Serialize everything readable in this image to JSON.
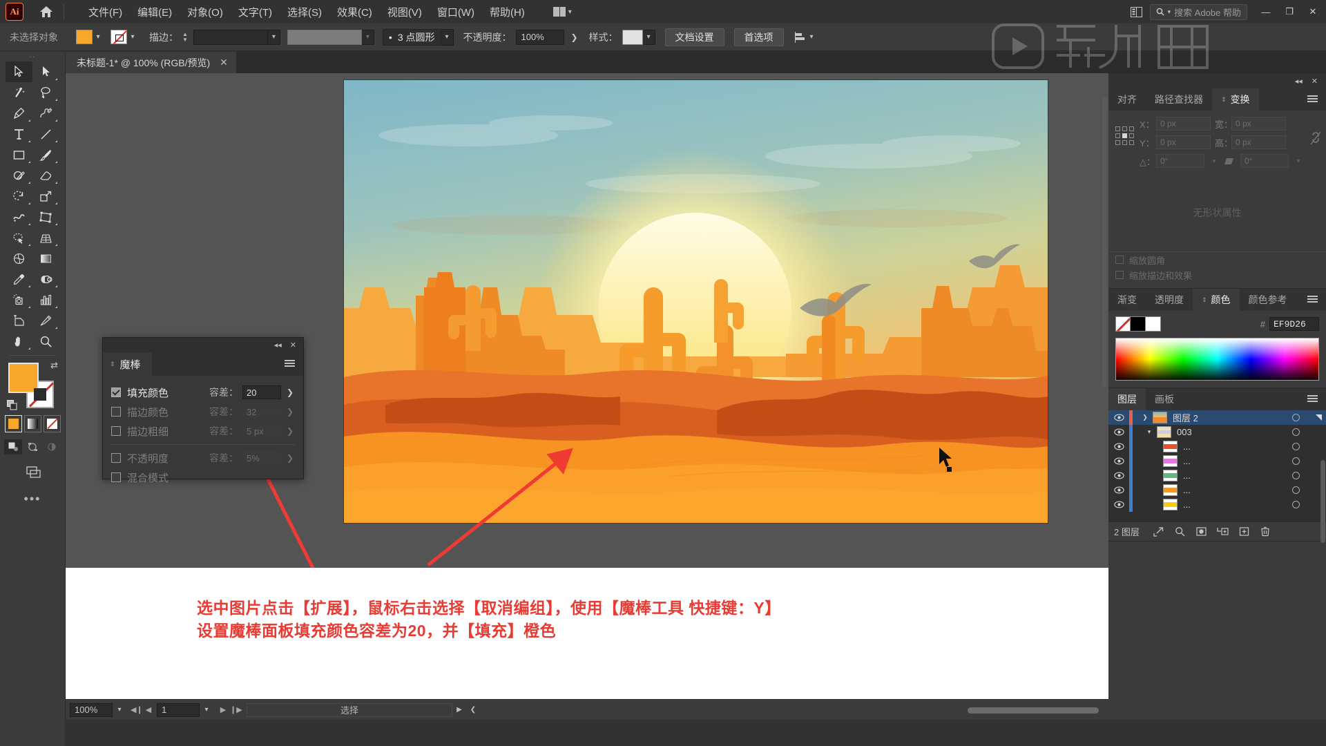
{
  "app": {
    "logo_text": "Ai",
    "title_suffix": ""
  },
  "menubar": {
    "items": [
      "文件(F)",
      "编辑(E)",
      "对象(O)",
      "文字(T)",
      "选择(S)",
      "效果(C)",
      "视图(V)",
      "窗口(W)",
      "帮助(H)"
    ],
    "home_icon": "home-icon",
    "workspace_icon": "workspace-switcher-icon",
    "search_placeholder": "搜索 Adobe 帮助",
    "search_icon": "search-icon",
    "arrange_icon": "arrange-documents-icon",
    "window_minimize": "—",
    "window_restore": "❐",
    "window_close": "✕"
  },
  "controlbar": {
    "selection_status": "未选择对象",
    "fill_swatch_color": "#F7A82B",
    "stroke_swatch": "none",
    "stroke_label": "描边：",
    "stroke_weight": "",
    "stroke_profile": "",
    "brush_bullet": "•",
    "brush_label": "3 点圆形",
    "opacity_label": "不透明度：",
    "opacity_value": "100%",
    "style_label": "样式：",
    "doc_setup_button": "文档设置",
    "preferences_button": "首选项",
    "align_icon": "align-icon"
  },
  "document_tab": {
    "title": "未标题-1* @ 100% (RGB/预览)",
    "close": "✕"
  },
  "toolbar": {
    "tools": [
      {
        "name": "selection-tool",
        "active": true
      },
      {
        "name": "direct-selection-tool",
        "active": false
      },
      {
        "name": "magic-wand-tool",
        "active": false
      },
      {
        "name": "lasso-tool",
        "active": false
      },
      {
        "name": "pen-tool",
        "active": false
      },
      {
        "name": "curvature-tool",
        "active": false
      },
      {
        "name": "type-tool",
        "active": false
      },
      {
        "name": "line-segment-tool",
        "active": false
      },
      {
        "name": "rectangle-tool",
        "active": false
      },
      {
        "name": "paintbrush-tool",
        "active": false
      },
      {
        "name": "shaper-tool",
        "active": false
      },
      {
        "name": "eraser-tool",
        "active": false
      },
      {
        "name": "rotate-tool",
        "active": false
      },
      {
        "name": "scale-tool",
        "active": false
      },
      {
        "name": "width-tool",
        "active": false
      },
      {
        "name": "free-transform-tool",
        "active": false
      },
      {
        "name": "shape-builder-tool",
        "active": false
      },
      {
        "name": "perspective-grid-tool",
        "active": false
      },
      {
        "name": "mesh-tool",
        "active": false
      },
      {
        "name": "gradient-tool",
        "active": false
      },
      {
        "name": "eyedropper-tool",
        "active": false
      },
      {
        "name": "blend-tool",
        "active": false
      },
      {
        "name": "symbol-sprayer-tool",
        "active": false
      },
      {
        "name": "column-graph-tool",
        "active": false
      },
      {
        "name": "artboard-tool",
        "active": false
      },
      {
        "name": "slice-tool",
        "active": false
      },
      {
        "name": "hand-tool",
        "active": false
      },
      {
        "name": "zoom-tool",
        "active": false
      }
    ],
    "fill_color": "#F7A82B",
    "stroke_color": "none",
    "swap_icon": "swap-fill-stroke-icon",
    "default_icon": "default-fill-stroke-icon",
    "paint_modes": [
      "color-swatch-mode",
      "gradient-mode",
      "none-mode"
    ],
    "draw_modes": [
      "draw-normal",
      "draw-behind",
      "draw-inside"
    ],
    "screen_mode_icon": "change-screen-mode-icon",
    "more_icon": "edit-toolbar-icon"
  },
  "magic_wand_panel": {
    "tab_title": "魔棒",
    "collapse_icon": "collapse-panel-icon",
    "close_icon": "close-panel-icon",
    "menu_icon": "panel-menu-icon",
    "rows": [
      {
        "label": "填充颜色",
        "checked": true,
        "tol_label": "容差：",
        "value": "20",
        "enabled": true
      },
      {
        "label": "描边颜色",
        "checked": false,
        "tol_label": "容差：",
        "value": "32",
        "enabled": false
      },
      {
        "label": "描边粗细",
        "checked": false,
        "tol_label": "容差：",
        "value": "5 px",
        "enabled": false
      },
      {
        "label": "不透明度",
        "checked": false,
        "tol_label": "容差：",
        "value": "5%",
        "enabled": false
      },
      {
        "label": "混合模式",
        "checked": false,
        "tol_label": "",
        "value": "",
        "enabled": false
      }
    ]
  },
  "dock": {
    "collapse_icon": "collapse-dock-icon",
    "close_icon": "close-dock-icon",
    "transform_panel": {
      "tabs": [
        "对齐",
        "路径查找器",
        "变换"
      ],
      "active_tab": "变换",
      "reference_point_icon": "reference-point-selector",
      "x_label": "X：",
      "x_value": "0 px",
      "y_label": "Y：",
      "y_value": "0 px",
      "w_label": "宽：",
      "w_value": "0 px",
      "h_label": "高：",
      "h_value": "0 px",
      "link_icon": "constrain-proportions-icon",
      "angle_label": "△：",
      "angle_value": "0°",
      "shear_label": "shear",
      "shear_value": "0°",
      "no_props_text": "无形状属性",
      "checkboxes": [
        "缩放圆角",
        "缩放描边和效果"
      ]
    },
    "color_panel": {
      "tabs": [
        "渐变",
        "透明度",
        "颜色",
        "颜色参考"
      ],
      "active_tab": "颜色",
      "hash": "#",
      "hex_value": "EF9D26",
      "none_swatch": "none-swatch",
      "black_swatch": "#000000",
      "white_swatch": "#FFFFFF"
    },
    "layers_panel": {
      "tabs": [
        "图层",
        "画板"
      ],
      "active_tab": "图层",
      "rows": [
        {
          "name": "图层 2",
          "selected": true,
          "indent": 0,
          "twisty": "collapsed",
          "bar_color": "#e8604c",
          "thumb": "artwork",
          "eye_icon": "eye-icon",
          "target_icon": "target-circle-icon"
        },
        {
          "name": "003",
          "selected": false,
          "indent": 1,
          "twisty": "expanded",
          "bar_color": "#3f7fd0",
          "thumb": "group",
          "eye_icon": "eye-icon",
          "target_icon": "target-circle-icon"
        },
        {
          "name": "...",
          "selected": false,
          "indent": 2,
          "twisty": "none",
          "bar_color": "#3f7fd0",
          "thumb": "#e8502a",
          "eye_icon": "eye-icon",
          "target_icon": "target-circle-icon"
        },
        {
          "name": "...",
          "selected": false,
          "indent": 2,
          "twisty": "none",
          "bar_color": "#3f7fd0",
          "thumb": "#e07ae0",
          "eye_icon": "eye-icon",
          "target_icon": "target-circle-icon"
        },
        {
          "name": "...",
          "selected": false,
          "indent": 2,
          "twisty": "none",
          "bar_color": "#3f7fd0",
          "thumb": "#5dbb7d",
          "eye_icon": "eye-icon",
          "target_icon": "target-circle-icon"
        },
        {
          "name": "...",
          "selected": false,
          "indent": 2,
          "twisty": "none",
          "bar_color": "#3f7fd0",
          "thumb": "#f0992e",
          "eye_icon": "eye-icon",
          "target_icon": "target-circle-icon"
        },
        {
          "name": "...",
          "selected": false,
          "indent": 2,
          "twisty": "none",
          "bar_color": "#3f7fd0",
          "thumb": "#f5cd12",
          "eye_icon": "eye-icon",
          "target_icon": "target-circle-icon"
        }
      ],
      "footer_count": "2 图层",
      "footer_icons": [
        "locate-object-icon",
        "search-icon",
        "make-clipping-mask-icon",
        "create-sublayer-icon",
        "create-new-layer-icon",
        "delete-layer-icon"
      ]
    }
  },
  "statusbar": {
    "zoom_value": "100%",
    "page_value": "1",
    "status_text": "选择",
    "first_icon": "first-page-icon",
    "prev_icon": "prev-page-icon",
    "next_icon": "next-page-icon",
    "last_icon": "last-page-icon"
  },
  "annotation": {
    "line1": "选中图片点击【扩展】，鼠标右击选择【取消编组】，使用【魔棒工具 快捷键：Y】",
    "line2": "设置魔棒面板填充颜色容差为20，并【填充】橙色",
    "color": "#E83B33",
    "arrow1": "red-arrow-to-magic-wand-panel",
    "arrow2": "red-arrow-to-canvas"
  },
  "watermark": {
    "text": "虎课网"
  },
  "canvas": {
    "artwork_name": "desert-sunset-illustration",
    "cursor": "magic-wand-cursor"
  }
}
